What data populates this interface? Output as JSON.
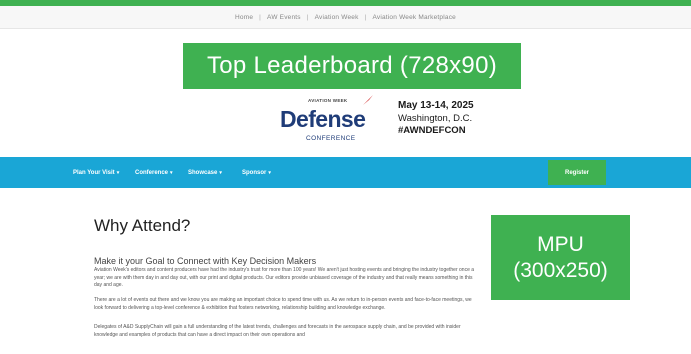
{
  "utility_nav": {
    "links": [
      "Home",
      "AW Events",
      "Aviation Week",
      "Aviation Week Marketplace"
    ]
  },
  "ads": {
    "leaderboard": "Top Leaderboard (728x90)",
    "mpu_line1": "MPU",
    "mpu_line2": "(300x250)"
  },
  "logo": {
    "brand": "AVIATION WEEK",
    "name": "Defense",
    "sub": "CONFERENCE"
  },
  "event": {
    "date": "May 13-14, 2025",
    "location": "Washington, D.C.",
    "hashtag": "#AWNDEFCON"
  },
  "nav": {
    "items": [
      {
        "label": "Plan Your Visit"
      },
      {
        "label": "Conference"
      },
      {
        "label": "Showcase"
      },
      {
        "label": "Sponsor"
      }
    ],
    "register": "Register"
  },
  "content": {
    "title": "Why Attend?",
    "subtitle": "Make it your Goal to Connect with Key Decision Makers",
    "p1": "Aviation Week's editors and content producers have had the industry's trust for more than 100 years! We aren't just hosting events and bringing the industry together once a year; we are with them day in and day out, with our print and digital products. Our editors provide unbiased coverage of the industry and that really means something in this day and age.",
    "p2": "There are a lot of events out there and we know you are making an important choice to spend time with us. As we return to in-person events and face-to-face meetings, we look forward to delivering a top-level conference & exhibition that fosters networking, relationship building and knowledge exchange.",
    "p3": "Delegates of A&D SupplyChain will gain a full understanding of the latest trends, challenges and forecasts in the aerospace supply chain, and be provided with insider knowledge and examples of products that can have a direct impact on their own operations and"
  },
  "colors": {
    "accent_green": "#3fb151",
    "nav_blue": "#1aa6d6",
    "logo_navy": "#1f3c78"
  }
}
